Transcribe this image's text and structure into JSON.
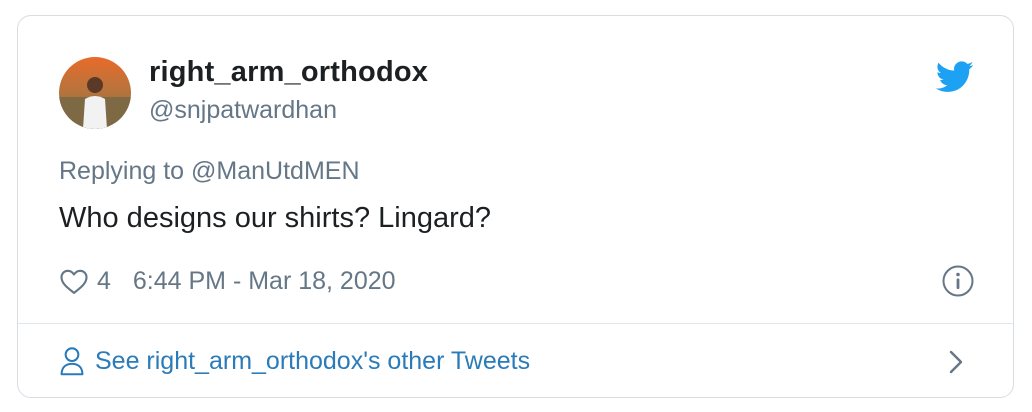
{
  "tweet": {
    "display_name": "right_arm_orthodox",
    "handle": "@snjpatwardhan",
    "replying_prefix": "Replying to",
    "replying_to": "@ManUtdMEN",
    "text": "Who designs our shirts? Lingard?",
    "like_count": "4",
    "timestamp": "6:44 PM - Mar 18, 2020",
    "other_tweets_label": "See right_arm_orthodox's other Tweets"
  },
  "icons": {
    "brand": "twitter-bird-icon",
    "like": "heart-icon",
    "info": "info-icon",
    "profile": "person-icon",
    "navigate": "chevron-right-icon"
  },
  "colors": {
    "twitter_blue": "#1da1f2",
    "link_blue": "#2b7bb9",
    "text_dark": "#1c2022",
    "text_muted": "#657786",
    "border": "#d7dde3"
  }
}
